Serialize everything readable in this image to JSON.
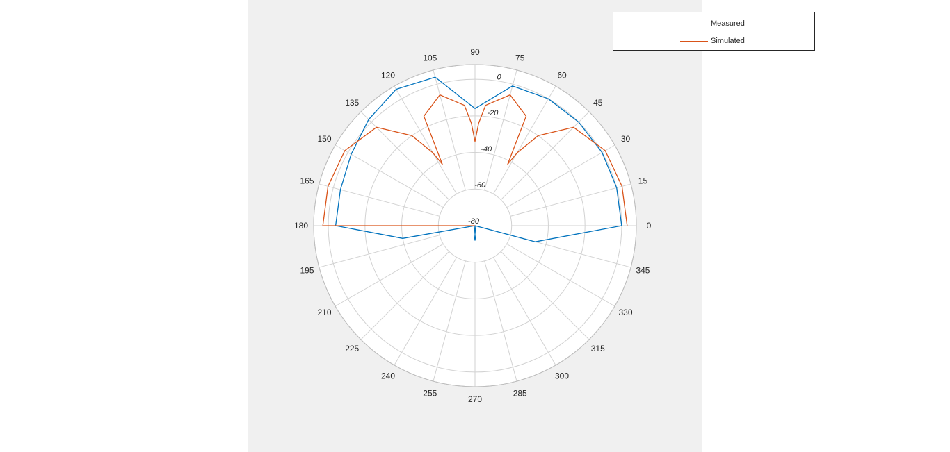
{
  "chart_data": {
    "type": "polar",
    "title": "",
    "theta_unit": "degrees",
    "theta_ticks": [
      0,
      15,
      30,
      45,
      60,
      75,
      90,
      105,
      120,
      135,
      150,
      165,
      180,
      195,
      210,
      225,
      240,
      255,
      270,
      285,
      300,
      315,
      330,
      345
    ],
    "theta_tick_labels": [
      "0",
      "15",
      "30",
      "45",
      "60",
      "75",
      "90",
      "105",
      "120",
      "135",
      "150",
      "165",
      "180",
      "195",
      "210",
      "225",
      "240",
      "255",
      "270",
      "285",
      "300",
      "315",
      "330",
      "345"
    ],
    "r_ticks": [
      -80,
      -60,
      -40,
      -20,
      0
    ],
    "r_tick_labels": [
      "-80",
      "-60",
      "-40",
      "-20",
      "0"
    ],
    "rlim": [
      -80,
      8
    ],
    "r_label_angle": 80,
    "grid": true,
    "legend": {
      "placement": "top-right",
      "entries": [
        "Measured",
        "Simulated"
      ]
    },
    "series": [
      {
        "name": "Measured",
        "color": "#0072bd",
        "theta": [
          0,
          15,
          30,
          45,
          60,
          75,
          90,
          105,
          120,
          135,
          150,
          165,
          180,
          190,
          195,
          210,
          225,
          240,
          255,
          260,
          265,
          270,
          275,
          280,
          285,
          300,
          315,
          330,
          345,
          360
        ],
        "r": [
          0,
          0,
          0,
          0,
          0,
          -1,
          -16,
          4,
          6,
          2,
          -2,
          -4,
          -4,
          -40,
          -80,
          -80,
          -80,
          -80,
          -80,
          -80,
          -75,
          -72,
          -75,
          -80,
          -80,
          -80,
          -80,
          -80,
          -46,
          0
        ]
      },
      {
        "name": "Simulated",
        "color": "#d95319",
        "theta": [
          0,
          15,
          30,
          45,
          55,
          60,
          62,
          65,
          75,
          85,
          88,
          90,
          92,
          95,
          105,
          115,
          118,
          120,
          125,
          135,
          150,
          165,
          180,
          180,
          0
        ],
        "r": [
          3,
          3,
          2,
          -4,
          -20,
          -34,
          -42,
          -14,
          -6,
          -14,
          -24,
          -34,
          -24,
          -14,
          -6,
          -14,
          -42,
          -34,
          -20,
          -4,
          2,
          3,
          3,
          -80,
          -80
        ]
      }
    ]
  }
}
